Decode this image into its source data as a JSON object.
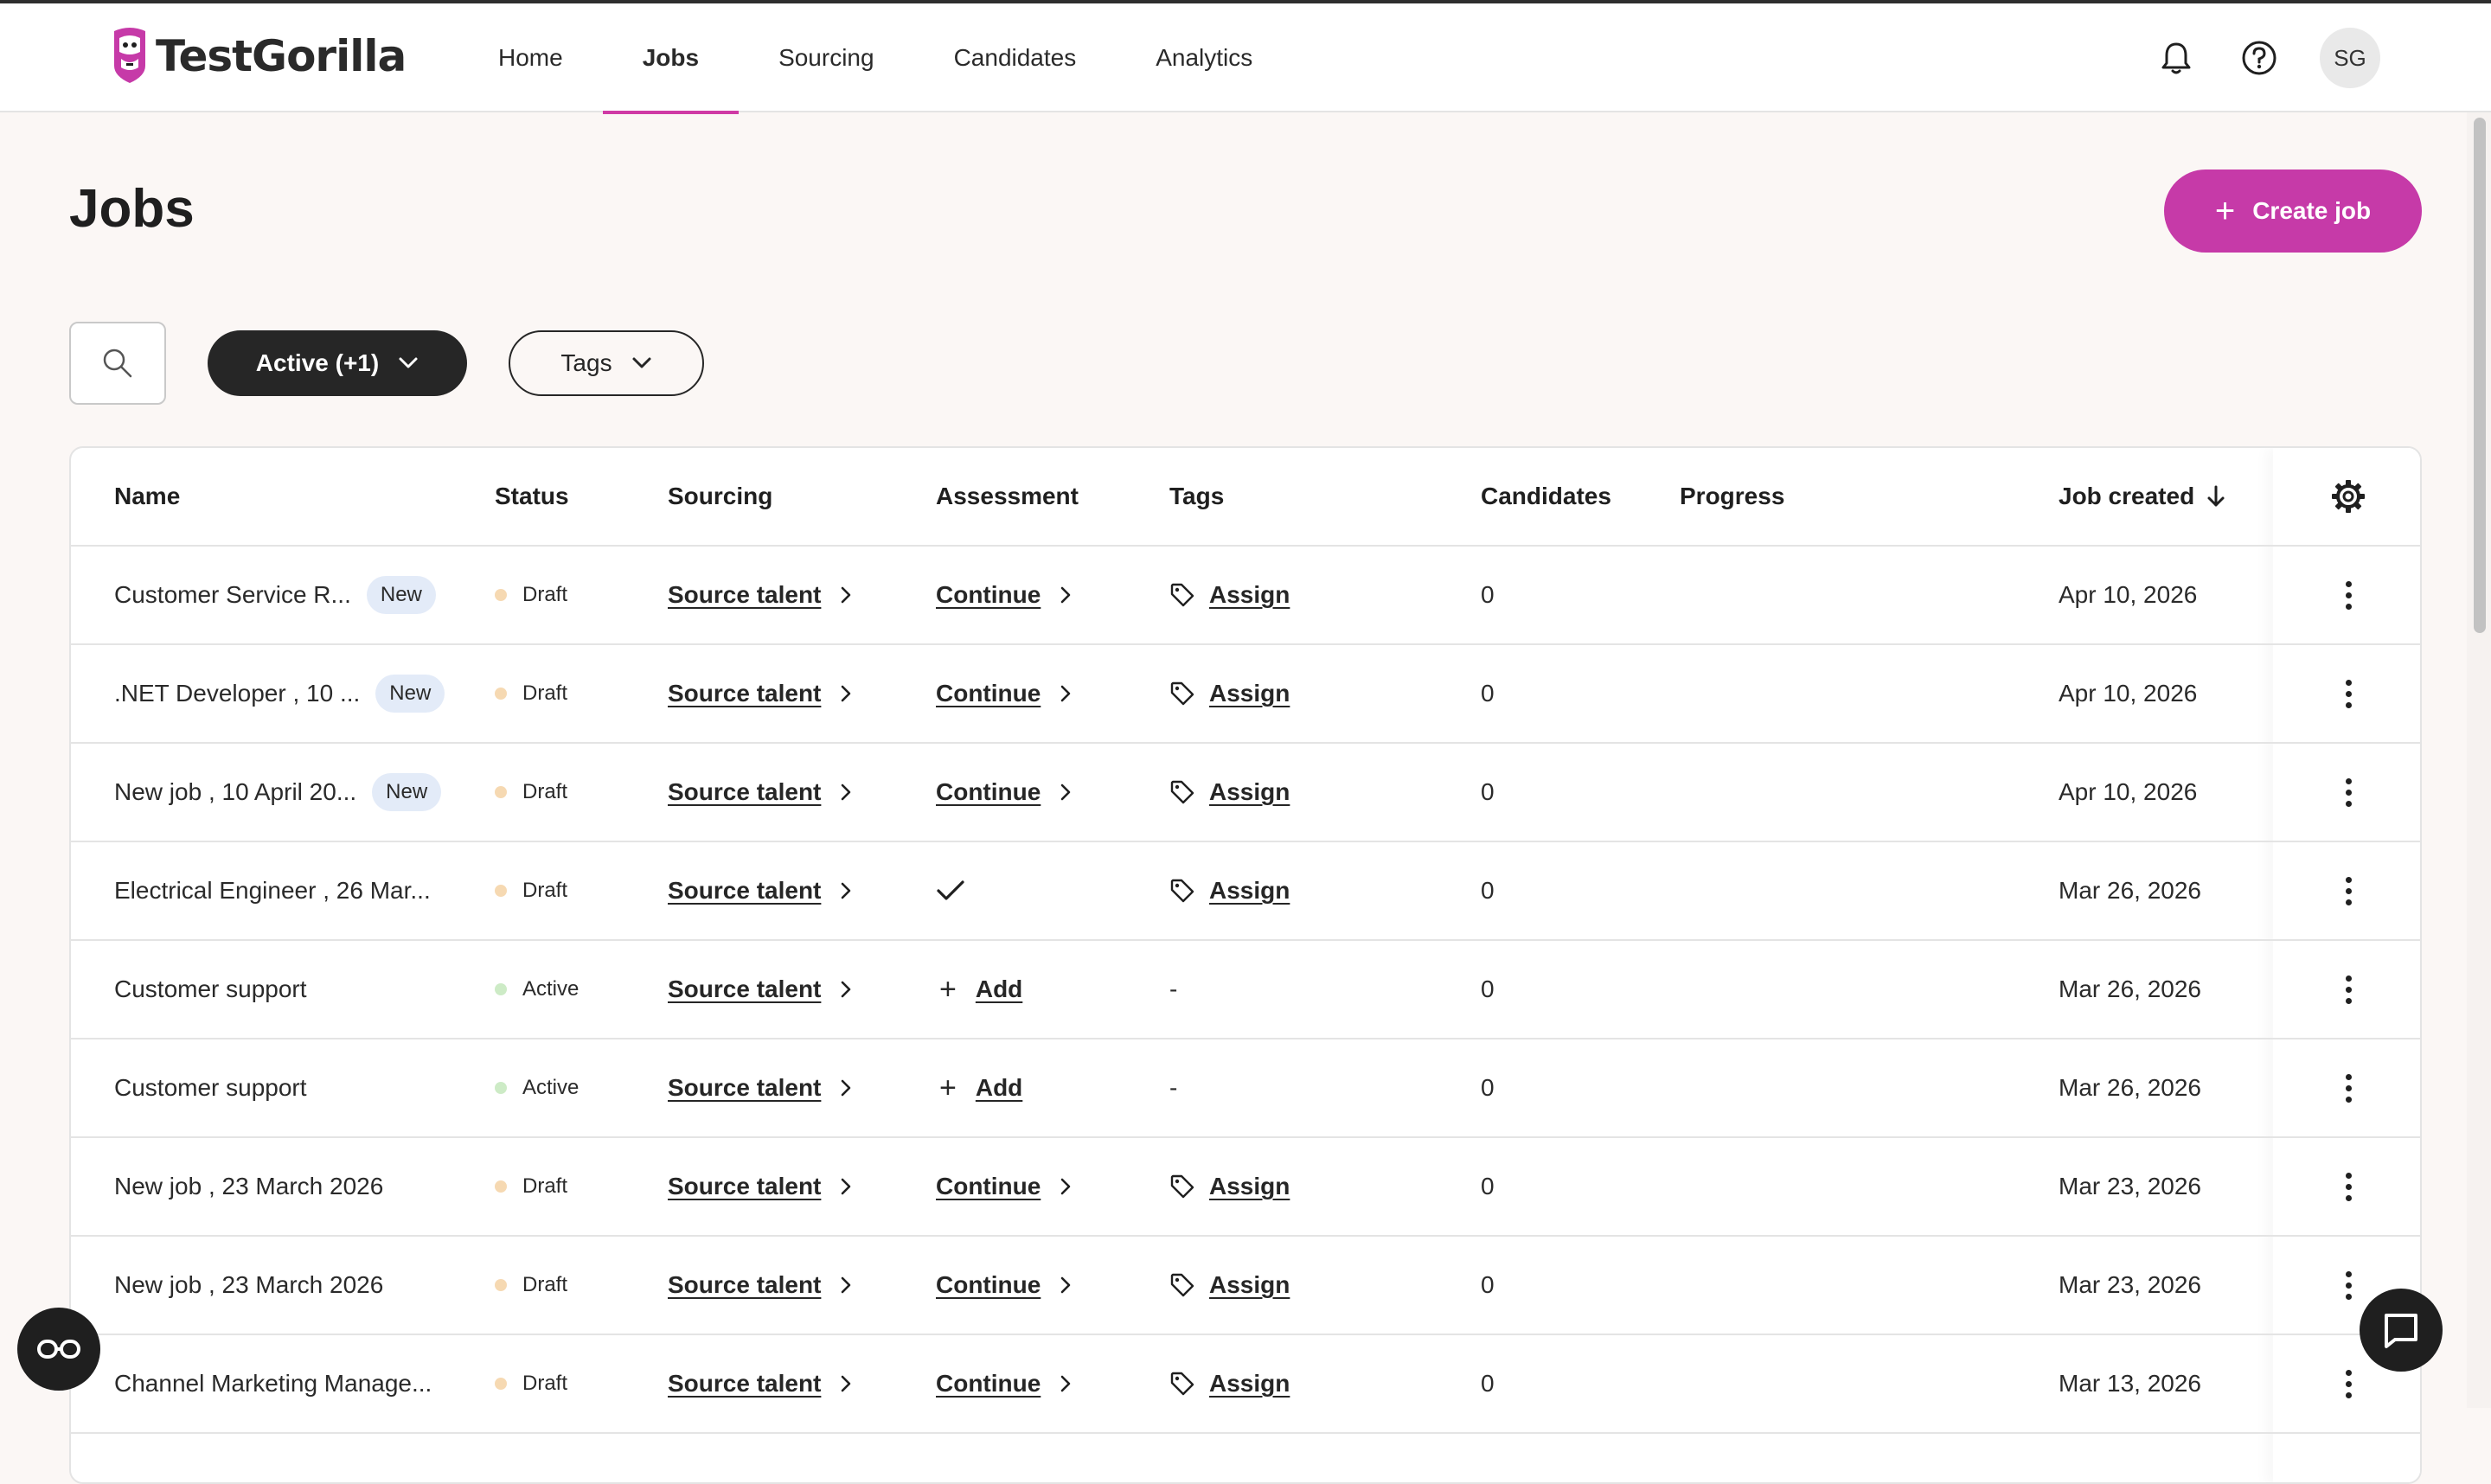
{
  "app": {
    "brand": "TestGorilla",
    "colors": {
      "accent": "#c63aa8",
      "nav_underline": "#cf3aa5",
      "dark": "#262626",
      "draft_dot": "#f6d9b2",
      "active_dot": "#cdebc6",
      "new_badge_bg": "#e3ebf8"
    }
  },
  "nav": {
    "items": [
      {
        "label": "Home"
      },
      {
        "label": "Jobs",
        "active": true
      },
      {
        "label": "Sourcing"
      },
      {
        "label": "Candidates"
      },
      {
        "label": "Analytics"
      }
    ]
  },
  "header_right": {
    "icons": [
      "bell-icon",
      "help-circle-icon"
    ],
    "avatar_initials": "SG"
  },
  "page": {
    "title": "Jobs",
    "create_button": "Create job"
  },
  "filters": {
    "status_label": "Active (+1)",
    "tags_label": "Tags"
  },
  "table": {
    "columns": {
      "name": "Name",
      "status": "Status",
      "sourcing": "Sourcing",
      "assessment": "Assessment",
      "tags": "Tags",
      "candidates": "Candidates",
      "progress": "Progress",
      "job_created": "Job created"
    },
    "rows": [
      {
        "name": "Customer Service R...",
        "badge": "New",
        "status": "Draft",
        "sourcing": "Source talent",
        "assessment": "Continue",
        "tags": "Assign",
        "candidates": "0",
        "created": "Apr 10, 2026"
      },
      {
        "name": ".NET Developer , 10 ...",
        "badge": "New",
        "status": "Draft",
        "sourcing": "Source talent",
        "assessment": "Continue",
        "tags": "Assign",
        "candidates": "0",
        "created": "Apr 10, 2026"
      },
      {
        "name": "New job , 10 April 20...",
        "badge": "New",
        "status": "Draft",
        "sourcing": "Source talent",
        "assessment": "Continue",
        "tags": "Assign",
        "candidates": "0",
        "created": "Apr 10, 2026"
      },
      {
        "name": "Electrical Engineer , 26 Mar...",
        "badge": "",
        "status": "Draft",
        "sourcing": "Source talent",
        "assessment": "check",
        "tags": "Assign",
        "candidates": "0",
        "created": "Mar 26, 2026"
      },
      {
        "name": "Customer support",
        "badge": "",
        "status": "Active",
        "sourcing": "Source talent",
        "assessment": "Add",
        "tags": "-",
        "candidates": "0",
        "created": "Mar 26, 2026"
      },
      {
        "name": "Customer support",
        "badge": "",
        "status": "Active",
        "sourcing": "Source talent",
        "assessment": "Add",
        "tags": "-",
        "candidates": "0",
        "created": "Mar 26, 2026"
      },
      {
        "name": "New job , 23 March 2026",
        "badge": "",
        "status": "Draft",
        "sourcing": "Source talent",
        "assessment": "Continue",
        "tags": "Assign",
        "candidates": "0",
        "created": "Mar 23, 2026"
      },
      {
        "name": "New job , 23 March 2026",
        "badge": "",
        "status": "Draft",
        "sourcing": "Source talent",
        "assessment": "Continue",
        "tags": "Assign",
        "candidates": "0",
        "created": "Mar 23, 2026"
      },
      {
        "name": "Channel Marketing Manage...",
        "badge": "",
        "status": "Draft",
        "sourcing": "Source talent",
        "assessment": "Continue",
        "tags": "Assign",
        "candidates": "0",
        "created": "Mar 13, 2026"
      }
    ]
  }
}
